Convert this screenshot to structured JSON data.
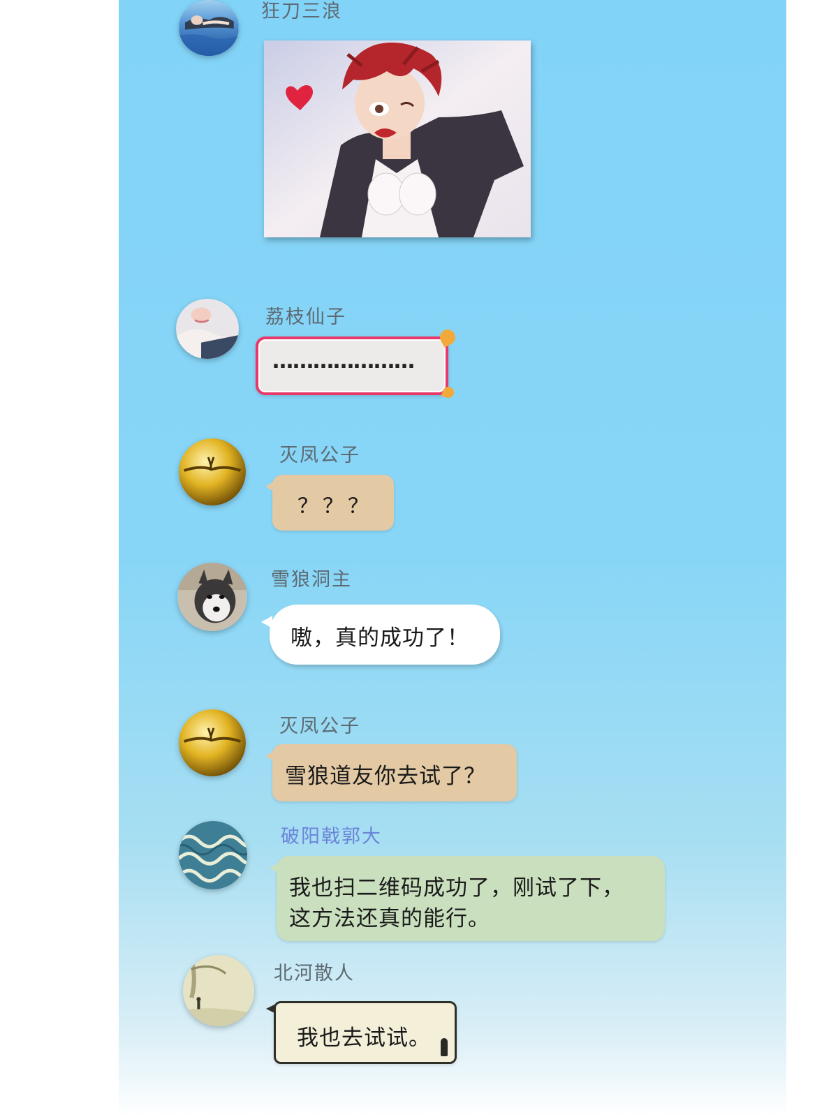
{
  "colors": {
    "background_top": "#82d3f8",
    "background_bottom": "#ffffff",
    "name_gray": "#5d6a72",
    "name_highlight": "#6b84d8",
    "bubble_tan": "#e3c9a4",
    "bubble_green": "#c9dfbe",
    "bubble_white": "#ffffff",
    "bubble_parchment": "#f3efd9",
    "frame_pink": "#e8386a"
  },
  "messages": [
    {
      "sender": "狂刀三浪",
      "avatar_icon": "woman-in-water-icon",
      "type": "image",
      "image_icon": "red-haired-character-wink-icon"
    },
    {
      "sender": "荔枝仙子",
      "avatar_icon": "woman-portrait-icon",
      "type": "text",
      "text": "…………………",
      "bubble_style": "pink-frame"
    },
    {
      "sender": "灭凤公子",
      "avatar_icon": "golden-orb-icon",
      "type": "text",
      "text": "？？？",
      "bubble_style": "tan"
    },
    {
      "sender": "雪狼洞主",
      "avatar_icon": "husky-dog-icon",
      "type": "text",
      "text": "嗷，真的成功了！",
      "bubble_style": "white"
    },
    {
      "sender": "灭凤公子",
      "avatar_icon": "golden-orb-icon",
      "type": "text",
      "text": "雪狼道友你去试了？",
      "bubble_style": "tan"
    },
    {
      "sender": "破阳戟郭大",
      "avatar_icon": "wave-pattern-icon",
      "type": "text",
      "text_line1": "我也扫二维码成功了，刚试了下，",
      "text_line2": "这方法还真的能行。",
      "bubble_style": "green"
    },
    {
      "sender": "北河散人",
      "avatar_icon": "landscape-painting-icon",
      "type": "text",
      "text": "我也去试试。",
      "bubble_style": "parchment-scroll"
    }
  ]
}
